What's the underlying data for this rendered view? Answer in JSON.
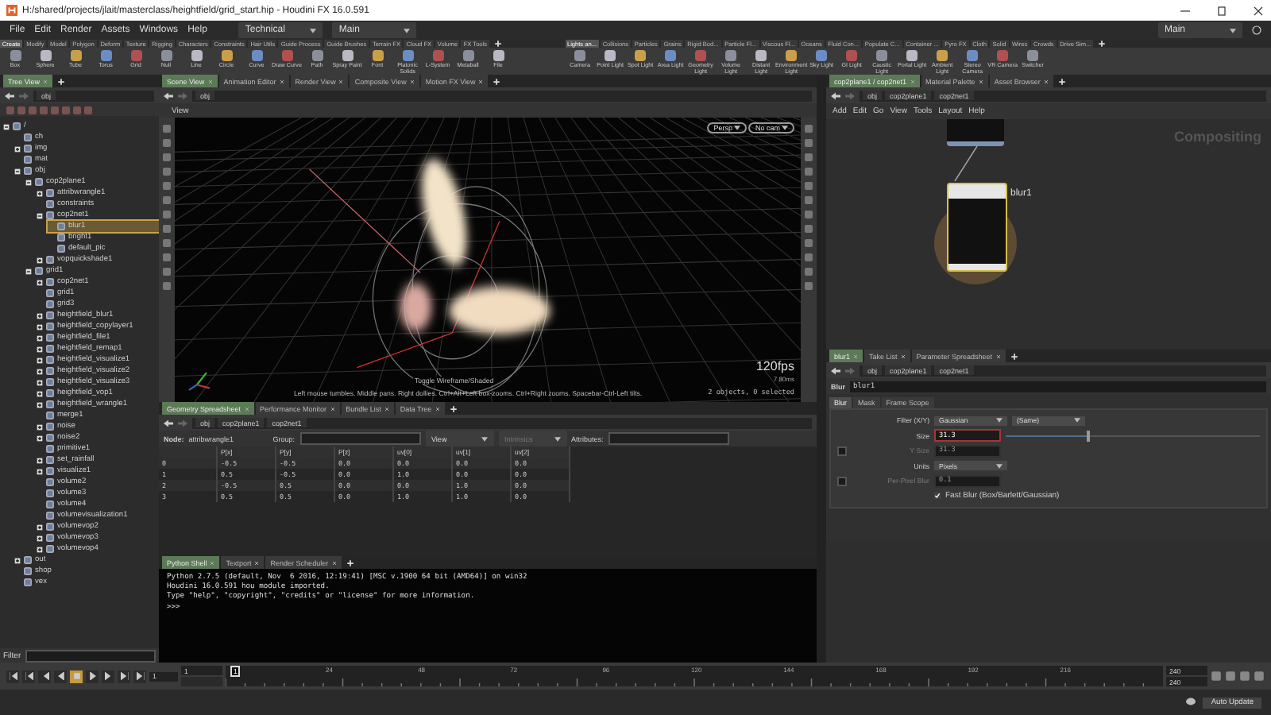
{
  "window": {
    "title": "H:/shared/projects/jlait/masterclass/heightfield/grid_start.hip - Houdini FX 16.0.591"
  },
  "menu": [
    "File",
    "Edit",
    "Render",
    "Assets",
    "Windows",
    "Help"
  ],
  "desktop": "Technical",
  "layout_left": "Main",
  "layout_right": "Main",
  "shelf_left": {
    "tabs": [
      {
        "label": "Create",
        "selected": true
      },
      {
        "label": "Modify",
        "selected": false
      },
      {
        "label": "Model",
        "selected": false
      },
      {
        "label": "Polygon",
        "selected": false
      },
      {
        "label": "Deform",
        "selected": false
      },
      {
        "label": "Texture",
        "selected": false
      },
      {
        "label": "Rigging",
        "selected": false
      },
      {
        "label": "Characters",
        "selected": false
      },
      {
        "label": "Constraints",
        "selected": false
      },
      {
        "label": "Hair Utils",
        "selected": false
      },
      {
        "label": "Guide Process",
        "selected": false
      },
      {
        "label": "Guide Brushes",
        "selected": false
      },
      {
        "label": "Terrain FX",
        "selected": false
      },
      {
        "label": "Cloud FX",
        "selected": false
      },
      {
        "label": "Volume",
        "selected": false
      },
      {
        "label": "FX Tools",
        "selected": false
      }
    ],
    "tools": [
      "Box",
      "Sphere",
      "Tube",
      "Torus",
      "Grid",
      "Null",
      "Line",
      "Circle",
      "Curve",
      "Draw Curve",
      "Path",
      "Spray Paint",
      "Font",
      "Platonic Solids",
      "L-System",
      "Metaball",
      "File"
    ]
  },
  "shelf_right": {
    "tabs": [
      {
        "label": "Lights an...",
        "selected": true
      },
      {
        "label": "Collisions",
        "selected": false
      },
      {
        "label": "Particles",
        "selected": false
      },
      {
        "label": "Grains",
        "selected": false
      },
      {
        "label": "Rigid Bod...",
        "selected": false
      },
      {
        "label": "Particle Fl...",
        "selected": false
      },
      {
        "label": "Viscous Fl...",
        "selected": false
      },
      {
        "label": "Oceans",
        "selected": false
      },
      {
        "label": "Fluid Con...",
        "selected": false
      },
      {
        "label": "Populate C...",
        "selected": false
      },
      {
        "label": "Container ...",
        "selected": false
      },
      {
        "label": "Pyro FX",
        "selected": false
      },
      {
        "label": "Cloth",
        "selected": false
      },
      {
        "label": "Solid",
        "selected": false
      },
      {
        "label": "Wires",
        "selected": false
      },
      {
        "label": "Crowds",
        "selected": false
      },
      {
        "label": "Drive Sim...",
        "selected": false
      }
    ],
    "tools": [
      "Camera",
      "Point Light",
      "Spot Light",
      "Area Light",
      "Geometry Light",
      "Volume Light",
      "Distant Light",
      "Environment Light",
      "Sky Light",
      "GI Light",
      "Caustic Light",
      "Portal Light",
      "Ambient Light",
      "Stereo Camera",
      "VR Camera",
      "Switcher"
    ]
  },
  "tree_view": {
    "tab": "Tree View",
    "path": "obj",
    "filter_label": "Filter",
    "items": [
      {
        "label": "/",
        "expanded": true,
        "selected": false,
        "children": [
          {
            "label": "ch",
            "selected": false
          },
          {
            "label": "img",
            "expanded": false,
            "selected": false
          },
          {
            "label": "mat",
            "selected": false
          },
          {
            "label": "obj",
            "expanded": true,
            "selected": false,
            "children": [
              {
                "label": "cop2plane1",
                "expanded": true,
                "selected": false,
                "children": [
                  {
                    "label": "attribwrangle1",
                    "expanded": false,
                    "selected": false
                  },
                  {
                    "label": "constraints",
                    "selected": false
                  },
                  {
                    "label": "cop2net1",
                    "expanded": true,
                    "selected": false,
                    "children": [
                      {
                        "label": "blur1",
                        "selected": true
                      },
                      {
                        "label": "bright1",
                        "selected": false
                      },
                      {
                        "label": "default_pic",
                        "selected": false
                      }
                    ]
                  },
                  {
                    "label": "vopquickshade1",
                    "expanded": false,
                    "selected": false
                  }
                ]
              },
              {
                "label": "grid1",
                "expanded": true,
                "selected": false,
                "children": [
                  {
                    "label": "cop2net1",
                    "expanded": false,
                    "selected": false
                  },
                  {
                    "label": "grid1",
                    "selected": false
                  },
                  {
                    "label": "grid3",
                    "selected": false
                  },
                  {
                    "label": "heightfield_blur1",
                    "expanded": false,
                    "selected": false
                  },
                  {
                    "label": "heightfield_copylayer1",
                    "expanded": false,
                    "selected": false
                  },
                  {
                    "label": "heightfield_file1",
                    "expanded": false,
                    "selected": false
                  },
                  {
                    "label": "heightfield_remap1",
                    "expanded": false,
                    "selected": false
                  },
                  {
                    "label": "heightfield_visualize1",
                    "expanded": false,
                    "selected": false
                  },
                  {
                    "label": "heightfield_visualize2",
                    "expanded": false,
                    "selected": false
                  },
                  {
                    "label": "heightfield_visualize3",
                    "expanded": false,
                    "selected": false
                  },
                  {
                    "label": "heightfield_vop1",
                    "expanded": false,
                    "selected": false
                  },
                  {
                    "label": "heightfield_wrangle1",
                    "expanded": false,
                    "selected": false
                  },
                  {
                    "label": "merge1",
                    "selected": false
                  },
                  {
                    "label": "noise",
                    "expanded": false,
                    "selected": false
                  },
                  {
                    "label": "noise2",
                    "expanded": false,
                    "selected": false
                  },
                  {
                    "label": "primitive1",
                    "selected": false
                  },
                  {
                    "label": "set_rainfall",
                    "expanded": false,
                    "selected": false
                  },
                  {
                    "label": "visualize1",
                    "expanded": false,
                    "selected": false
                  },
                  {
                    "label": "volume2",
                    "selected": false
                  },
                  {
                    "label": "volume3",
                    "selected": false
                  },
                  {
                    "label": "volume4",
                    "selected": false
                  },
                  {
                    "label": "volumevisualization1",
                    "selected": false
                  },
                  {
                    "label": "volumevop2",
                    "expanded": false,
                    "selected": false
                  },
                  {
                    "label": "volumevop3",
                    "expanded": false,
                    "selected": false
                  },
                  {
                    "label": "volumevop4",
                    "expanded": false,
                    "selected": false
                  }
                ]
              }
            ]
          },
          {
            "label": "out",
            "expanded": false,
            "selected": false
          },
          {
            "label": "shop",
            "selected": false
          },
          {
            "label": "vex",
            "selected": false
          }
        ]
      }
    ]
  },
  "scene_view": {
    "tabs": [
      {
        "label": "Scene View",
        "selected": true
      },
      {
        "label": "Animation Editor",
        "selected": false
      },
      {
        "label": "Render View",
        "selected": false
      },
      {
        "label": "Composite View",
        "selected": false
      },
      {
        "label": "Motion FX View",
        "selected": false
      }
    ],
    "path": [
      "obj"
    ],
    "title": "View",
    "camera": "Persp",
    "cam_menu": "No cam",
    "fps": "120fps",
    "frame_time": "7.80ms",
    "toggle_hint": "Toggle Wireframe/Shaded",
    "help": "Left mouse tumbles. Middle pans. Right dollies. Ctrl+Alt+Left box-zooms. Ctrl+Right zooms. Spacebar-Ctrl-Left tilts.",
    "selection": "2 objects, 0 selected"
  },
  "spreadsheet": {
    "tabs": [
      {
        "label": "Geometry Spreadsheet",
        "selected": true
      },
      {
        "label": "Performance Monitor",
        "selected": false
      },
      {
        "label": "Bundle List",
        "selected": false
      },
      {
        "label": "Data Tree",
        "selected": false
      }
    ],
    "path": [
      "obj",
      "cop2plane1",
      "cop2net1"
    ],
    "node_label": "Node:",
    "node": "attribwrangle1",
    "group_label": "Group:",
    "view": "View",
    "intrinsics": "Intrinsics",
    "attributes_label": "Attributes:",
    "columns": [
      "",
      "P[x]",
      "P[y]",
      "P[z]",
      "uv[0]",
      "uv[1]",
      "uv[2]"
    ],
    "rows": [
      [
        "0",
        "-0.5",
        "-0.5",
        "0.0",
        "0.0",
        "0.0",
        "0.0"
      ],
      [
        "1",
        "0.5",
        "-0.5",
        "0.0",
        "1.0",
        "0.0",
        "0.0"
      ],
      [
        "2",
        "-0.5",
        "0.5",
        "0.0",
        "0.0",
        "1.0",
        "0.0"
      ],
      [
        "3",
        "0.5",
        "0.5",
        "0.0",
        "1.0",
        "1.0",
        "0.0"
      ]
    ]
  },
  "python_shell": {
    "tabs": [
      {
        "label": "Python Shell",
        "selected": true
      },
      {
        "label": "Textport",
        "selected": false
      },
      {
        "label": "Render Scheduler",
        "selected": false
      }
    ],
    "lines": [
      "Python 2.7.5 (default, Nov  6 2016, 12:19:41) [MSC v.1900 64 bit (AMD64)] on win32",
      "Houdini 16.0.591 hou module imported.",
      "Type \"help\", \"copyright\", \"credits\" or \"license\" for more information.",
      ">>>"
    ]
  },
  "network": {
    "tabs": [
      {
        "label": "cop2plane1 / cop2net1",
        "selected": true
      },
      {
        "label": "Material Palette",
        "selected": false
      },
      {
        "label": "Asset Browser",
        "selected": false
      }
    ],
    "path": [
      "obj",
      "cop2plane1",
      "cop2net1"
    ],
    "menu": [
      "Add",
      "Edit",
      "Go",
      "View",
      "Tools",
      "Layout",
      "Help"
    ],
    "context": "Compositing",
    "node": "blur1"
  },
  "parameters": {
    "tabs": [
      {
        "label": "blur1",
        "selected": true
      },
      {
        "label": "Take List",
        "selected": false
      },
      {
        "label": "Parameter Spreadsheet",
        "selected": false
      }
    ],
    "path": [
      "obj",
      "cop2plane1",
      "cop2net1"
    ],
    "type": "Blur",
    "name": "blur1",
    "sections": [
      {
        "label": "Blur",
        "selected": true
      },
      {
        "label": "Mask",
        "selected": false
      },
      {
        "label": "Frame Scope",
        "selected": false
      }
    ],
    "params": [
      {
        "kind": "menu",
        "label": "Filter (X/Y)",
        "values": [
          "Gaussian",
          "(Same)"
        ]
      },
      {
        "kind": "slider",
        "label": "Size",
        "value": "31.3",
        "level": 0.32
      },
      {
        "kind": "field",
        "label": "Y Size",
        "value": "31.3",
        "disabled": true,
        "checked": false
      },
      {
        "kind": "menu",
        "label": "Units",
        "values": [
          "Pixels"
        ]
      },
      {
        "kind": "field",
        "label": "Per-Pixel Blur",
        "value": "0.1",
        "disabled": true,
        "checked": false
      },
      {
        "kind": "toggle",
        "label": "Fast Blur (Box/Barlett/Gaussian)",
        "checked": true
      }
    ]
  },
  "timeline": {
    "start": "1",
    "range_start": "1",
    "current": "1",
    "ticks": [
      "24",
      "48",
      "72",
      "96",
      "120",
      "144",
      "168",
      "192",
      "216"
    ],
    "end": "240",
    "range_end": "240"
  },
  "status": {
    "auto_update": "Auto Update"
  }
}
